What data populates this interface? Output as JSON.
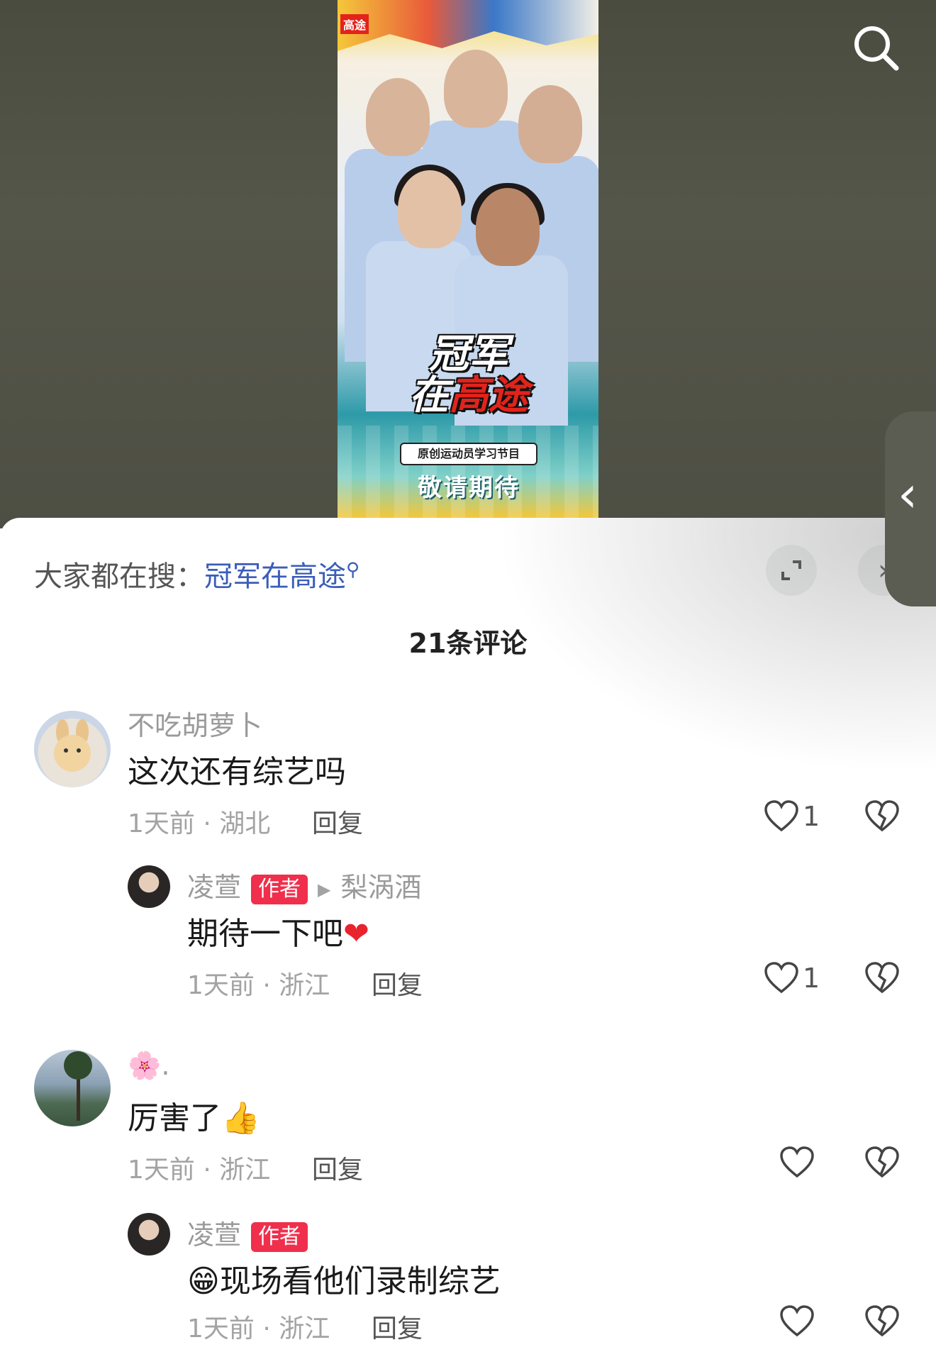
{
  "poster": {
    "corner_brand": "高途",
    "title_line1": "冠军",
    "title_line2a": "在",
    "title_line2b": "高途",
    "subtitle": "原创运动员学习节目",
    "stay_tuned": "敬请期待"
  },
  "hot_search": {
    "prefix": "大家都在搜：",
    "keyword": "冠军在高途"
  },
  "comment_count": "21条评论",
  "comments": [
    {
      "user": "不吃胡萝卜",
      "text": "这次还有综艺吗",
      "meta": "1天前 · 湖北",
      "reply": "回复",
      "likes": "1",
      "replies": [
        {
          "user": "凌萱",
          "tag": "作者",
          "reply_to": "梨涡酒",
          "text": "期待一下吧",
          "emoji": "❤",
          "meta": "1天前 · 浙江",
          "reply": "回复",
          "likes": "1"
        }
      ]
    },
    {
      "user": "🌸.",
      "text": "厉害了",
      "emoji": "👍",
      "meta": "1天前 · 浙江",
      "reply": "回复",
      "likes": "",
      "replies": [
        {
          "user": "凌萱",
          "tag": "作者",
          "emoji": "😁",
          "text": "现场看他们录制综艺",
          "meta": "1天前 · 浙江",
          "reply": "回复",
          "likes": ""
        }
      ]
    }
  ],
  "colors": {
    "author_tag": "#ef2f4c",
    "keyword": "#3a5db8",
    "heart": "#e8232e"
  }
}
